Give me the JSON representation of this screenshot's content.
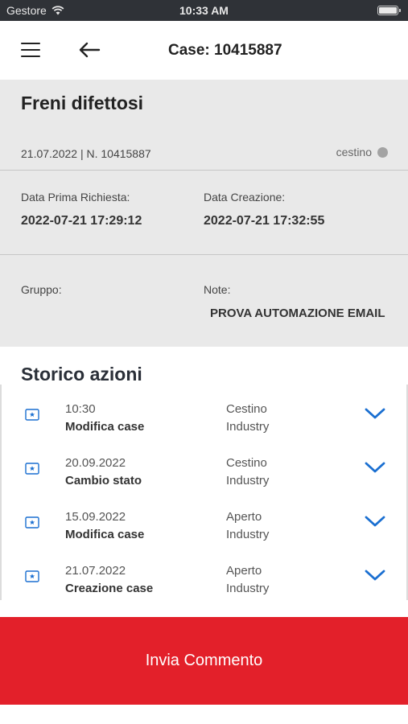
{
  "status_bar": {
    "carrier": "Gestore",
    "time": "10:33 AM"
  },
  "header": {
    "title": "Case: 10415887",
    "menu_icon": "hamburger-menu-icon",
    "back_icon": "arrow-left-icon"
  },
  "case": {
    "title": "Freni difettosi",
    "meta": "21.07.2022 | N. 10415887",
    "status": "cestino",
    "status_color": "#a3a3a3",
    "first_request_label": "Data Prima Richiesta:",
    "first_request_value": "2022-07-21 17:29:12",
    "created_label": "Data Creazione:",
    "created_value": "2022-07-21 17:32:55",
    "group_label": "Gruppo:",
    "group_value": "",
    "note_label": "Note:",
    "note_value": "PROVA AUTOMAZIONE EMAIL"
  },
  "history": {
    "title": "Storico azioni",
    "rows": [
      {
        "date": "10:30",
        "action": "Modifica case",
        "state": "Cestino",
        "category": "Industry"
      },
      {
        "date": "20.09.2022",
        "action": "Cambio stato",
        "state": "Cestino",
        "category": "Industry"
      },
      {
        "date": "15.09.2022",
        "action": "Modifica case",
        "state": "Aperto",
        "category": "Industry"
      },
      {
        "date": "21.07.2022",
        "action": "Creazione case",
        "state": "Aperto",
        "category": "Industry"
      }
    ]
  },
  "footer": {
    "send_label": "Invia Commento"
  },
  "colors": {
    "accent_blue": "#1a6fd1",
    "primary_red": "#e3202a",
    "info_background": "#e9e9e9"
  }
}
